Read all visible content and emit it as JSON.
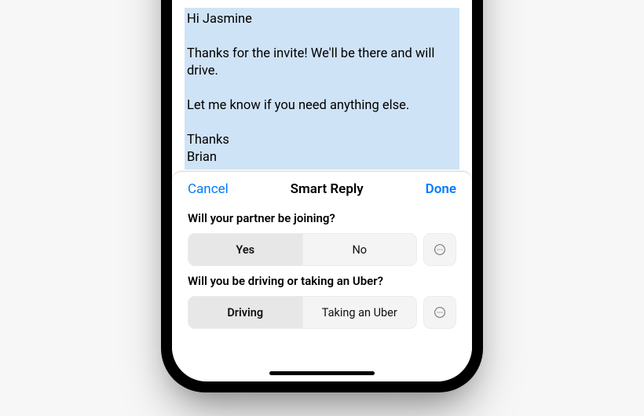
{
  "compose": {
    "body": "Hi Jasmine\n\nThanks for the invite! We'll be there and will drive.\n\nLet me know if you need anything else.\n\nThanks\nBrian"
  },
  "sheet": {
    "cancel_label": "Cancel",
    "title": "Smart Reply",
    "done_label": "Done",
    "questions": [
      {
        "prompt": "Will your partner be joining?",
        "options": [
          "Yes",
          "No"
        ],
        "selected_index": 0
      },
      {
        "prompt": "Will you be driving or taking an Uber?",
        "options": [
          "Driving",
          "Taking an Uber"
        ],
        "selected_index": 0
      }
    ]
  }
}
